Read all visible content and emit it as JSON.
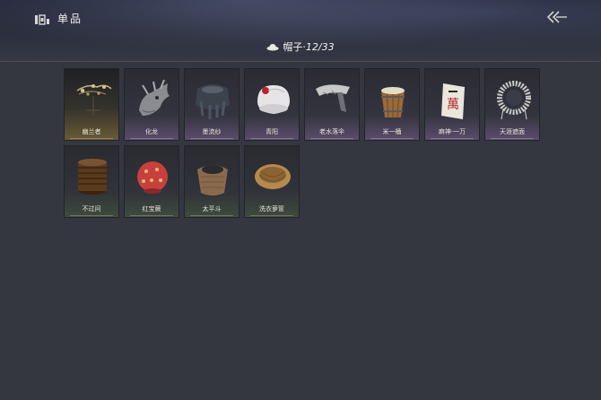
{
  "header": {
    "title": "单品",
    "title_icon": "wardrobe-icon",
    "back_icon": "double-chevron-left-icon"
  },
  "category": {
    "label": "帽子·",
    "count_text": "12/33",
    "icon": "hat-icon"
  },
  "items": [
    {
      "name": "幽兰者",
      "rarity": "gold",
      "icon": "hairpin-icon"
    },
    {
      "name": "化龙",
      "rarity": "purple",
      "icon": "dragon-head-icon"
    },
    {
      "name": "墨流纱",
      "rarity": "purple",
      "icon": "dark-veil-icon"
    },
    {
      "name": "青阳",
      "rarity": "purple",
      "icon": "white-cap-icon"
    },
    {
      "name": "老水落伞",
      "rarity": "purple",
      "icon": "silver-headdress-icon"
    },
    {
      "name": "米一桶",
      "rarity": "purple",
      "icon": "wooden-bucket-icon"
    },
    {
      "name": "麻神·一万",
      "rarity": "purple",
      "icon": "mahjong-tile-icon"
    },
    {
      "name": "天涯遮面",
      "rarity": "purple",
      "icon": "bamboo-veil-hat-icon"
    },
    {
      "name": "不过问",
      "rarity": "green",
      "icon": "stacked-bowls-icon"
    },
    {
      "name": "红宝蕨",
      "rarity": "green",
      "icon": "red-lantern-icon"
    },
    {
      "name": "太平斗",
      "rarity": "green",
      "icon": "woven-basket-icon"
    },
    {
      "name": "洗衣萝筐",
      "rarity": "green",
      "icon": "laundry-basket-icon"
    }
  ],
  "colors": {
    "background": "#34373f",
    "gold_rarity": "#6a5a36",
    "purple_rarity": "#5a4d6c",
    "green_rarity": "#3f4b3c"
  }
}
